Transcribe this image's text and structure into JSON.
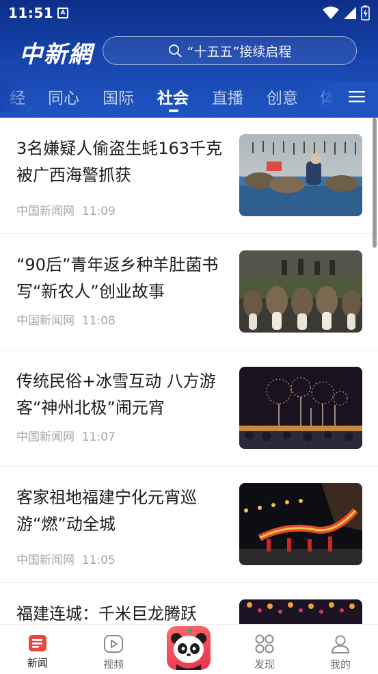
{
  "status_bar": {
    "time": "11:51",
    "app_icon_glyph": "A"
  },
  "header": {
    "logo_text": "中新網",
    "search": {
      "placeholder": "“十五五”接续启程"
    }
  },
  "channels": [
    {
      "label": "经",
      "active": false
    },
    {
      "label": "同心",
      "active": false
    },
    {
      "label": "国际",
      "active": false
    },
    {
      "label": "社会",
      "active": true
    },
    {
      "label": "直播",
      "active": false
    },
    {
      "label": "创意",
      "active": false
    },
    {
      "label": "体",
      "active": false
    }
  ],
  "news": [
    {
      "title": "3名嫌疑人偷盗生蚝163千克被广西海警抓获",
      "source": "中国新闻网",
      "time": "11:09",
      "thumb": "oyster-harvest-photo"
    },
    {
      "title": "“90后”青年返乡种羊肚菌书写“新农人”创业故事",
      "source": "中国新闻网",
      "time": "11:08",
      "thumb": "morel-mushroom-photo"
    },
    {
      "title": "传统民俗+冰雪互动 八方游客“神州北极”闹元宵",
      "source": "中国新闻网",
      "time": "11:07",
      "thumb": "fireworks-photo"
    },
    {
      "title": "客家祖地福建宁化元宵巡游“燃”动全城",
      "source": "中国新闻网",
      "time": "11:05",
      "thumb": "dragon-parade-photo"
    },
    {
      "title": "福建连城：千米巨龙腾跃",
      "source": "",
      "time": "",
      "thumb": "lantern-crowd-photo"
    }
  ],
  "bottom_nav": [
    {
      "label": "新闻",
      "icon": "news-icon",
      "active": true
    },
    {
      "label": "视频",
      "icon": "video-icon",
      "active": false
    },
    {
      "label": "",
      "icon": "panda-mascot-icon",
      "active": false
    },
    {
      "label": "发现",
      "icon": "discover-icon",
      "active": false
    },
    {
      "label": "我的",
      "icon": "profile-icon",
      "active": false
    }
  ],
  "colors": {
    "header_blue": "#1846b0",
    "accent_red": "#e8304a",
    "meta_gray": "#a6a6a6"
  }
}
